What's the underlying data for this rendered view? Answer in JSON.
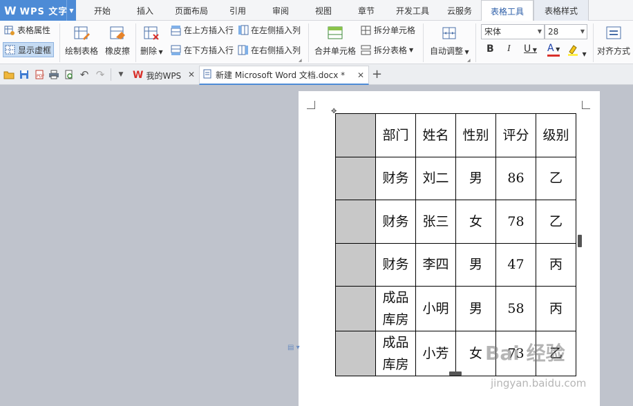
{
  "app": {
    "logo": "W",
    "title": "WPS 文字"
  },
  "menu": {
    "tabs": [
      "开始",
      "插入",
      "页面布局",
      "引用",
      "审阅",
      "视图",
      "章节",
      "开发工具",
      "云服务"
    ],
    "active_tab": "表格工具",
    "extra_tab": "表格样式"
  },
  "ribbon": {
    "table_props": "表格属性",
    "show_gridlines": "显示虚框",
    "draw_table": "绘制表格",
    "eraser": "橡皮擦",
    "delete": "删除",
    "insert_row_above": "在上方插入行",
    "insert_row_below": "在下方插入行",
    "insert_col_left": "在左侧插入列",
    "insert_col_right": "在右侧插入列",
    "merge_cells": "合并单元格",
    "split_cells": "拆分单元格",
    "split_table": "拆分表格",
    "auto_fit": "自动调整",
    "font_name": "宋体",
    "font_size": "28",
    "bold": "B",
    "italic": "I",
    "underline": "U",
    "font_color": "A",
    "align": "对齐方式"
  },
  "tabs": {
    "my_wps": "我的WPS",
    "document": "新建 Microsoft Word 文档.docx *"
  },
  "table": {
    "headers": [
      "部门",
      "姓名",
      "性别",
      "评分",
      "级别"
    ],
    "rows": [
      {
        "dept_line1": "财务",
        "dept_line2": "",
        "name": "刘二",
        "gender": "男",
        "score": "86",
        "grade": "乙"
      },
      {
        "dept_line1": "财务",
        "dept_line2": "",
        "name": "张三",
        "gender": "女",
        "score": "78",
        "grade": "乙"
      },
      {
        "dept_line1": "财务",
        "dept_line2": "",
        "name": "李四",
        "gender": "男",
        "score": "47",
        "grade": "丙"
      },
      {
        "dept_line1": "成品",
        "dept_line2": "库房",
        "name": "小明",
        "gender": "男",
        "score": "58",
        "grade": "丙"
      },
      {
        "dept_line1": "成品",
        "dept_line2": "库房",
        "name": "小芳",
        "gender": "女",
        "score": "73",
        "grade": "乙"
      }
    ]
  },
  "watermark": {
    "main": "Bai 经验",
    "sub": "jingyan.baidu.com"
  },
  "colors": {
    "accent": "#4d8bd6",
    "shade": "#c8c8c8",
    "workspace": "#bfc3cc"
  }
}
